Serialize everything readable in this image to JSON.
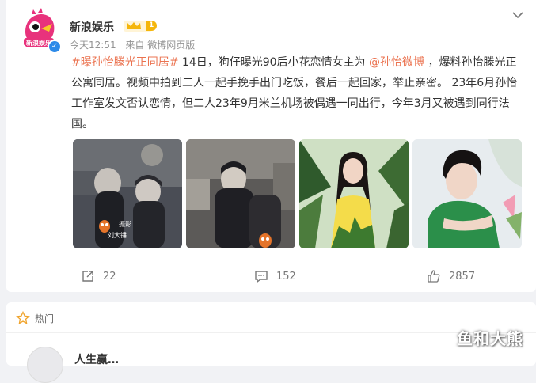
{
  "post": {
    "username": "新浪娱乐",
    "vip_level": "1",
    "time": "今天12:51",
    "source": "来自 微博网页版",
    "hashtag": "#曝孙怡滕光正同居#",
    "text_1": " 14日，狗仔曝光90后小花恋情女主为 ",
    "mention": "@孙怡微博",
    "text_2": " ，爆料孙怡滕光正公寓同居。视频中拍到二人一起手挽手出门吃饭，餐后一起回家，举止亲密。 23年6月孙怡工作室发文否认恋情，但二人23年9月米兰机场被偶遇一同出行，今年3月又被遇到同行法国。",
    "photo1_caption": "刘大锤",
    "photo1_label": "摄影",
    "photos": [
      "paparazzi-photo-1",
      "paparazzi-photo-2",
      "sun-yi-photo",
      "teng-guang-photo"
    ]
  },
  "actions": {
    "share_count": "22",
    "comment_count": "152",
    "like_count": "2857"
  },
  "hot": {
    "label": "热门",
    "next_user": "人生赢…"
  },
  "watermark": "鱼和大熊",
  "colors": {
    "link": "#eb7350",
    "vip": "#f5b60b",
    "verify": "#2d8ae8"
  }
}
